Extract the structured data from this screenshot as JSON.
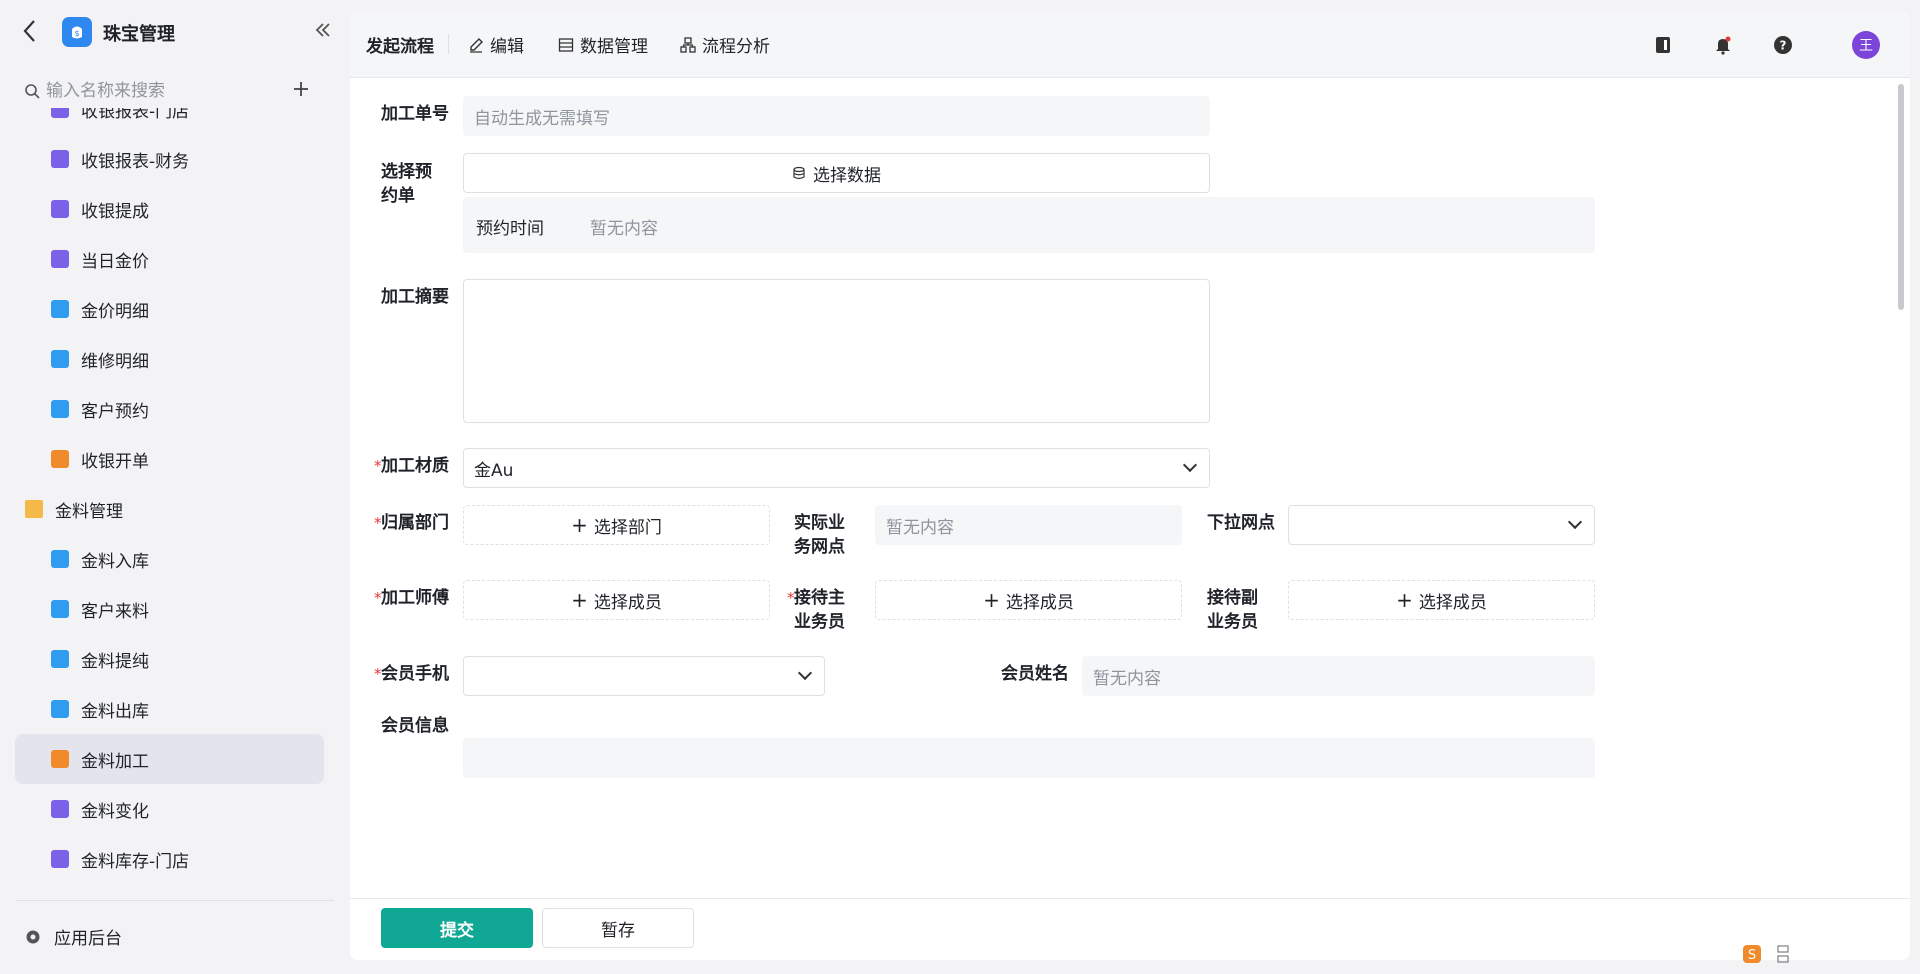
{
  "app": {
    "title": "珠宝管理",
    "search_placeholder": "输入名称来搜索"
  },
  "sidebar": {
    "items": [
      {
        "label": "收银报表-门店",
        "icon": "chart-icon"
      },
      {
        "label": "收银报表-财务",
        "icon": "chart-icon"
      },
      {
        "label": "收银提成",
        "icon": "chart-icon"
      },
      {
        "label": "当日金价",
        "icon": "chart-icon"
      },
      {
        "label": "金价明细",
        "icon": "doc-icon"
      },
      {
        "label": "维修明细",
        "icon": "doc-icon"
      },
      {
        "label": "客户预约",
        "icon": "doc-icon"
      },
      {
        "label": "收银开单",
        "icon": "form-icon"
      },
      {
        "label": "金料管理",
        "icon": "folder-icon"
      },
      {
        "label": "金料入库",
        "icon": "doc-icon"
      },
      {
        "label": "客户来料",
        "icon": "doc-icon"
      },
      {
        "label": "金料提纯",
        "icon": "doc-icon"
      },
      {
        "label": "金料出库",
        "icon": "doc-icon"
      },
      {
        "label": "金料加工",
        "icon": "form-icon",
        "active": true
      },
      {
        "label": "金料变化",
        "icon": "chart-icon"
      },
      {
        "label": "金料库存-门店",
        "icon": "chart-icon"
      }
    ],
    "footer_label": "应用后台"
  },
  "toolbar": {
    "start_flow": "发起流程",
    "edit": "编辑",
    "data_manage": "数据管理",
    "flow_analysis": "流程分析",
    "avatar_text": "王"
  },
  "form": {
    "order_no_label": "加工单号",
    "order_no_placeholder": "自动生成无需填写",
    "reservation_label": "选择预约单",
    "select_data": "选择数据",
    "reservation_time_label": "预约时间",
    "reservation_time_value": "暂无内容",
    "summary_label": "加工摘要",
    "material_label": "加工材质",
    "material_value": "金Au",
    "department_label": "归属部门",
    "select_department": "选择部门",
    "actual_outlet_label": "实际业务网点",
    "actual_outlet_value": "暂无内容",
    "sub_outlet_label": "下拉网点",
    "craftsman_label": "加工师傅",
    "select_member": "选择成员",
    "main_staff_label": "接待主业务员",
    "assist_staff_label": "接待副业务员",
    "member_phone_label": "会员手机",
    "member_name_label": "会员姓名",
    "member_name_value": "暂无内容",
    "member_info_label": "会员信息"
  },
  "footer": {
    "submit": "提交",
    "save_draft": "暂存"
  },
  "colors": {
    "accent": "#10a894",
    "required": "#e53935",
    "avatar": "#7a45d8",
    "logo": "#2f87f0"
  }
}
